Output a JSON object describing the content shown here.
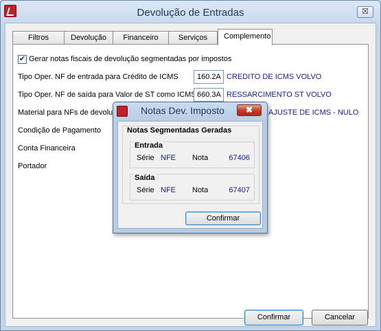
{
  "window": {
    "title": "Devolução de Entradas",
    "close_symbol": "☒"
  },
  "tabs": [
    {
      "label": "Filtros"
    },
    {
      "label": "Devolução"
    },
    {
      "label": "Financeiro"
    },
    {
      "label": "Serviços"
    },
    {
      "label": "Complemento"
    }
  ],
  "active_tab": "Complemento",
  "form": {
    "checkbox_label": "Gerar notas fiscais de devolução segmentadas por impostos",
    "checkbox_checked": true,
    "checkbox_mark": "✔",
    "tipo_entrada_label": "Tipo Oper. NF de entrada para Crédito de ICMS",
    "tipo_entrada_code": "160.2A",
    "tipo_entrada_desc": "CREDITO DE ICMS VOLVO",
    "tipo_saida_label": "Tipo Oper. NF de saída para Valor de ST como ICMS",
    "tipo_saida_code": "660.3A",
    "tipo_saida_desc": "RESSARCIMENTO ST VOLVO",
    "material_label": "Material para NFs de devoluç",
    "material_desc": "AJUSTE DE ICMS - NULO",
    "condicao_label": "Condição de Pagamento",
    "conta_label": "Conta Financeira",
    "portador_label": "Portador"
  },
  "buttons": {
    "confirmar": "Confirmar",
    "cancelar": "Cancelar"
  },
  "popup": {
    "title": "Notas Dev. Imposto",
    "close_symbol": "✖",
    "group_title": "Notas Segmentadas Geradas",
    "entrada": {
      "title": "Entrada",
      "serie_label": "Série",
      "serie": "NFE",
      "nota_label": "Nota",
      "nota": "67406"
    },
    "saida": {
      "title": "Saída",
      "serie_label": "Série",
      "serie": "NFE",
      "nota_label": "Nota",
      "nota": "67407"
    },
    "confirm_label": "Confirmar"
  },
  "colors": {
    "value_text": "#1a1a8c",
    "title_text": "#1e3957",
    "icon_red": "#c0202a"
  }
}
